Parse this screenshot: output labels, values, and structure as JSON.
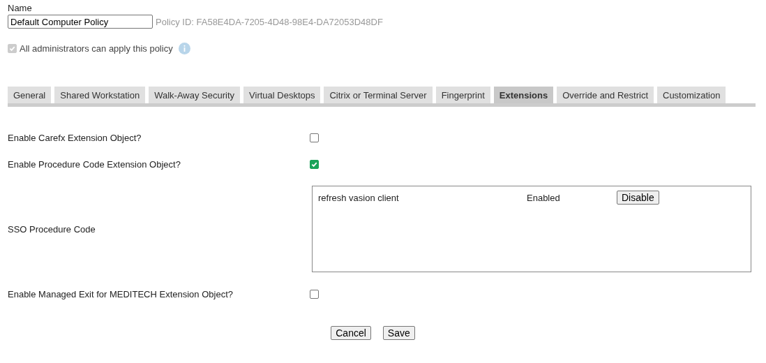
{
  "name_field": {
    "label": "Name",
    "value": "Default Computer Policy",
    "policy_id": "Policy ID: FA58E4DA-7205-4D48-98E4-DA72053D48DF"
  },
  "admin_option": {
    "label": "All administrators can apply this policy",
    "checked": true,
    "disabled": true
  },
  "tabs": [
    {
      "label": "General",
      "selected": false
    },
    {
      "label": "Shared Workstation",
      "selected": false
    },
    {
      "label": "Walk-Away Security",
      "selected": false
    },
    {
      "label": "Virtual Desktops",
      "selected": false
    },
    {
      "label": "Citrix or Terminal Server",
      "selected": false
    },
    {
      "label": "Fingerprint",
      "selected": false
    },
    {
      "label": "Extensions",
      "selected": true
    },
    {
      "label": "Override and Restrict",
      "selected": false
    },
    {
      "label": "Customization",
      "selected": false
    }
  ],
  "settings": [
    {
      "kind": "checkbox",
      "label": "Enable Carefx Extension Object?",
      "checked": false
    },
    {
      "kind": "checkbox",
      "label": "Enable Procedure Code Extension Object?",
      "checked": true
    },
    {
      "kind": "list",
      "label": "SSO Procedure Code",
      "items": [
        {
          "name": "refresh vasion client",
          "status": "Enabled",
          "action": "Disable"
        }
      ]
    },
    {
      "kind": "checkbox",
      "label": "Enable Managed Exit for MEDITECH Extension Object?",
      "checked": false
    }
  ],
  "buttons": [
    "Cancel",
    "Save"
  ]
}
